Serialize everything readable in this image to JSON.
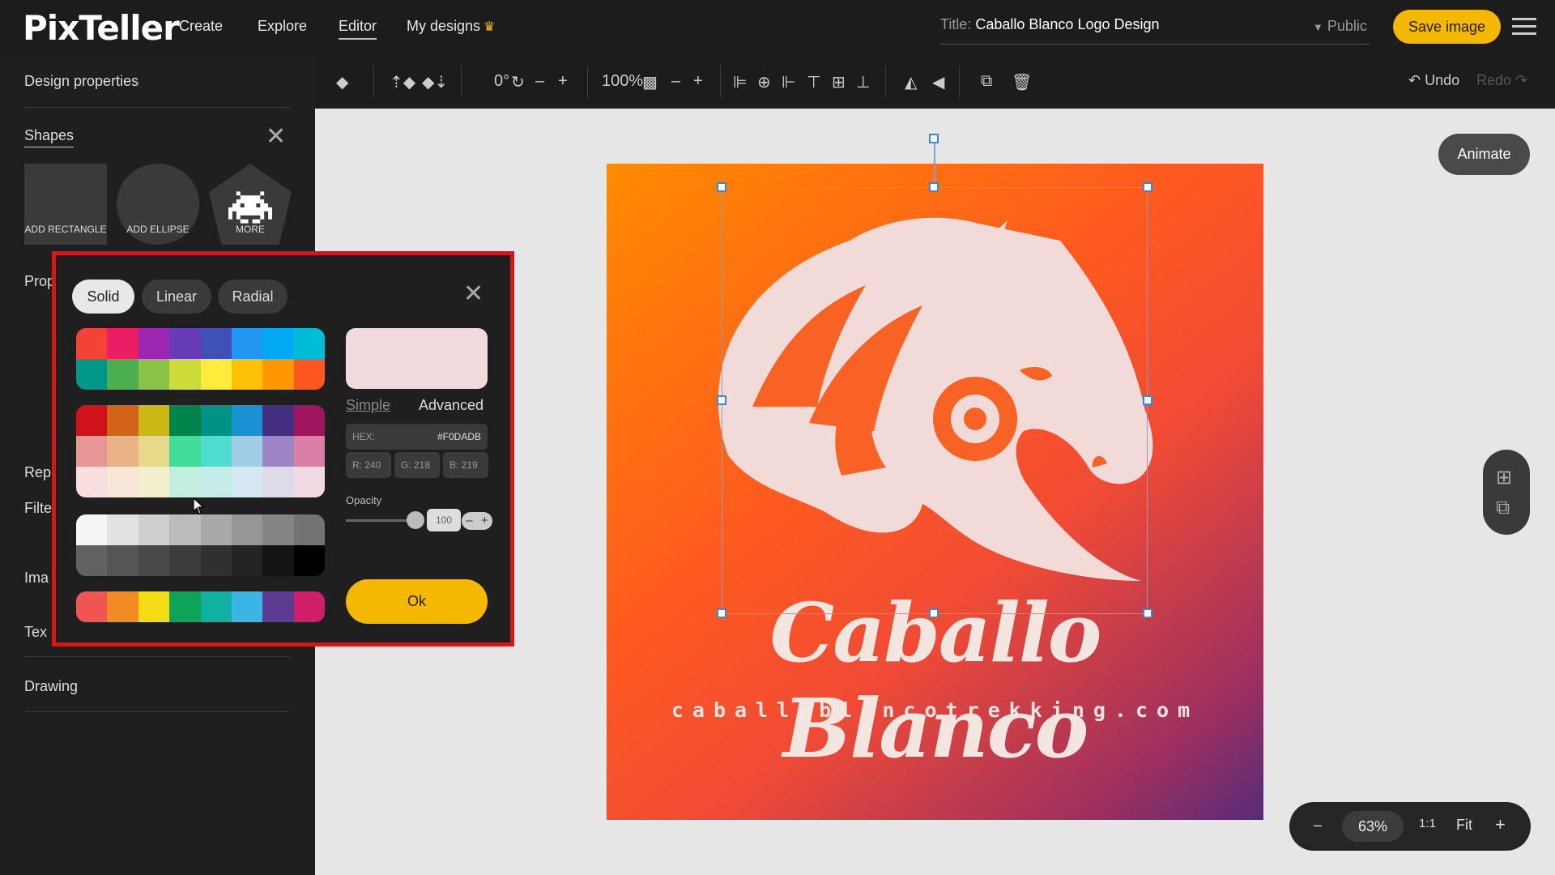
{
  "app": {
    "logo": "PixTeller"
  },
  "nav": {
    "create": "Create",
    "explore": "Explore",
    "editor": "Editor",
    "my_designs": "My designs"
  },
  "header": {
    "title_label": "Title:",
    "title_value": "Caballo Blanco Logo Design",
    "visibility": "Public",
    "save_label": "Save image"
  },
  "sidebar": {
    "design_properties": "Design properties",
    "shapes_title": "Shapes",
    "add_rectangle": "ADD RECTANGLE",
    "add_ellipse": "ADD ELLIPSE",
    "more": "MORE",
    "drawing": "Drawing",
    "partial_labels": [
      "Prop",
      "Rep",
      "Filte",
      "Ima",
      "Tex"
    ]
  },
  "toolbar": {
    "rotation": "0°",
    "zoom": "100%",
    "undo": "Undo",
    "redo": "Redo"
  },
  "canvas": {
    "brand_title": "Caballo Blanco",
    "brand_url": "caballoblancotrekking.com",
    "background_colors": [
      "#ff8b00",
      "#ff5a1f",
      "#f04a36",
      "#9b2f60",
      "#552b7a"
    ],
    "logo_color": "#F0DADB"
  },
  "animate_label": "Animate",
  "zoom_bar": {
    "minus": "–",
    "percent": "63%",
    "ratio": "1:1",
    "fit": "Fit",
    "plus": "+"
  },
  "color_picker": {
    "tabs": [
      "Solid",
      "Linear",
      "Radial"
    ],
    "selected_tab": "Solid",
    "mode_simple": "Simple",
    "mode_advanced": "Advanced",
    "hex_label": "HEX:",
    "hex_value": "#F0DADB",
    "r_label": "R: 240",
    "g_label": "G: 218",
    "b_label": "B: 219",
    "opacity_label": "Opacity",
    "opacity_value": "100",
    "opacity_minus": "–",
    "opacity_plus": "+",
    "ok_label": "Ok",
    "palette_1": [
      [
        "#f44336",
        "#e91e63",
        "#9c27b0",
        "#673ab7",
        "#3f51b5",
        "#2196f3",
        "#03a9f4",
        "#00bcd4"
      ],
      [
        "#009688",
        "#4caf50",
        "#8bc34a",
        "#cddc39",
        "#ffeb3b",
        "#ffc107",
        "#ff9800",
        "#ff5722"
      ]
    ],
    "palette_2": [
      [
        "#d0121b",
        "#d2641a",
        "#cab915",
        "#00844b",
        "#009284",
        "#1992d2",
        "#432e82",
        "#a0155e"
      ],
      [
        "#e79595",
        "#e9b387",
        "#e6da8a",
        "#41dc99",
        "#4fddd0",
        "#a0cde6",
        "#9c85c6",
        "#db7ea5"
      ],
      [
        "#f8dede",
        "#f8e6d8",
        "#f4efcd",
        "#c4eedf",
        "#c6ecea",
        "#d4e8f1",
        "#dedbe9",
        "#f0d9e2"
      ]
    ],
    "palette_3": [
      [
        "#f5f5f5",
        "#e2e2e2",
        "#cfcfcf",
        "#bcbcbc",
        "#a9a9a9",
        "#979797",
        "#858585",
        "#737373"
      ],
      [
        "#626262",
        "#555555",
        "#484848",
        "#3c3c3c",
        "#303030",
        "#232323",
        "#141414",
        "#000000"
      ]
    ],
    "palette_4": [
      "#f05552",
      "#f28b24",
      "#f5dd16",
      "#0da45a",
      "#10b1a1",
      "#3bb5e6",
      "#5b3c92",
      "#d01e6b"
    ]
  }
}
